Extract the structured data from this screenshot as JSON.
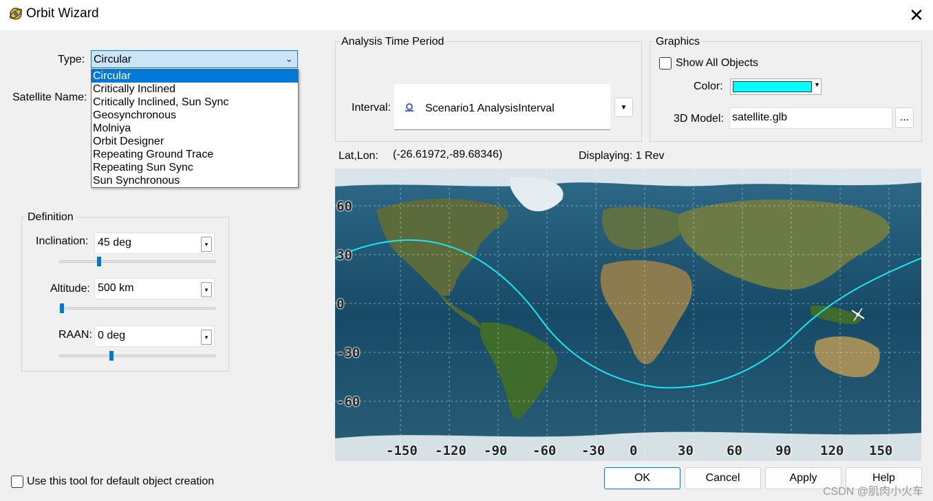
{
  "window": {
    "title": "Orbit Wizard"
  },
  "type_field": {
    "label": "Type:",
    "value": "Circular",
    "options": [
      "Circular",
      "Critically Inclined",
      "Critically Inclined, Sun Sync",
      "Geosynchronous",
      "Molniya",
      "Orbit Designer",
      "Repeating Ground Trace",
      "Repeating Sun Sync",
      "Sun Synchronous"
    ]
  },
  "satellite_name_label": "Satellite Name:",
  "definition": {
    "title": "Definition",
    "inclination": {
      "label": "Inclination:",
      "value": "45 deg"
    },
    "altitude": {
      "label": "Altitude:",
      "value": "500 km"
    },
    "raan": {
      "label": "RAAN:",
      "value": "0 deg"
    }
  },
  "analysis": {
    "title": "Analysis Time Period",
    "interval_label": "Interval:",
    "interval_value": "Scenario1 AnalysisInterval"
  },
  "graphics": {
    "title": "Graphics",
    "show_all": "Show All Objects",
    "color_label": "Color:",
    "color_value": "#00ffff",
    "model_label": "3D Model:",
    "model_value": "satellite.glb",
    "browse": "..."
  },
  "map": {
    "latlon_label": "Lat,Lon:",
    "latlon_value": "(-26.61972,-89.68346)",
    "displaying": "Displaying: 1 Rev",
    "lat_labels": [
      "60",
      "30",
      "0",
      "-30",
      "-60"
    ],
    "lon_labels": [
      "-150",
      "-120",
      "-90",
      "-60",
      "-30",
      "0",
      "30",
      "60",
      "90",
      "120",
      "150"
    ],
    "track_color": "#1ee6f0"
  },
  "footer": {
    "default_creation": "Use this tool for default object creation",
    "ok": "OK",
    "cancel": "Cancel",
    "apply": "Apply",
    "help": "Help",
    "watermark": "CSDN @肌肉小火车"
  }
}
